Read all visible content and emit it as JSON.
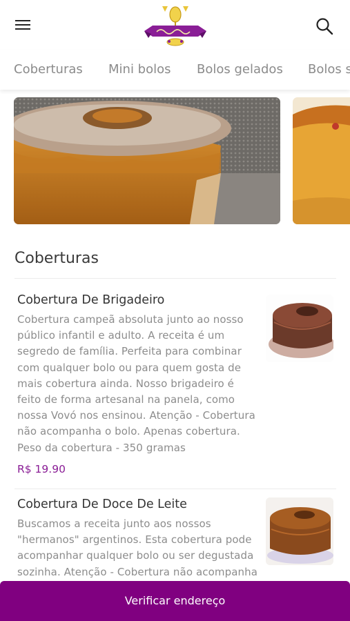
{
  "header": {
    "logo_icon": "sweet-company-logo",
    "menu_icon": "hamburger-menu-icon",
    "search_icon": "search-icon"
  },
  "tabs": [
    {
      "label": "Coberturas"
    },
    {
      "label": "Mini bolos"
    },
    {
      "label": "Bolos gelados"
    },
    {
      "label": "Bolos s"
    }
  ],
  "section": {
    "title": "Coberturas"
  },
  "products": [
    {
      "name": "Cobertura De Brigadeiro",
      "description": "Cobertura campeã absoluta junto ao nosso público infantil e adulto. A receita é um segredo de família. Perfeita para combinar com qualquer bolo ou para quem gosta de mais cobertura ainda. Nosso brigadeiro é feito de forma artesanal na panela, como nossa Vovó nos ensinou. Atenção - Cobertura não acompanha o bolo. Apenas cobertura. Peso da cobertura - 350 gramas",
      "price": "R$ 19.90"
    },
    {
      "name": "Cobertura De Doce De Leite",
      "description": "Buscamos a receita junto aos nossos \"hermanos\" argentinos. Esta cobertura pode acompanhar qualquer bolo ou ser degustada sozinha. Atenção - Cobertura não acompanha",
      "price": ""
    }
  ],
  "cta": {
    "label": "Verificar endereço"
  },
  "colors": {
    "accent": "#800080",
    "price": "#8a1e96",
    "tab_text": "#8b8b8b"
  }
}
